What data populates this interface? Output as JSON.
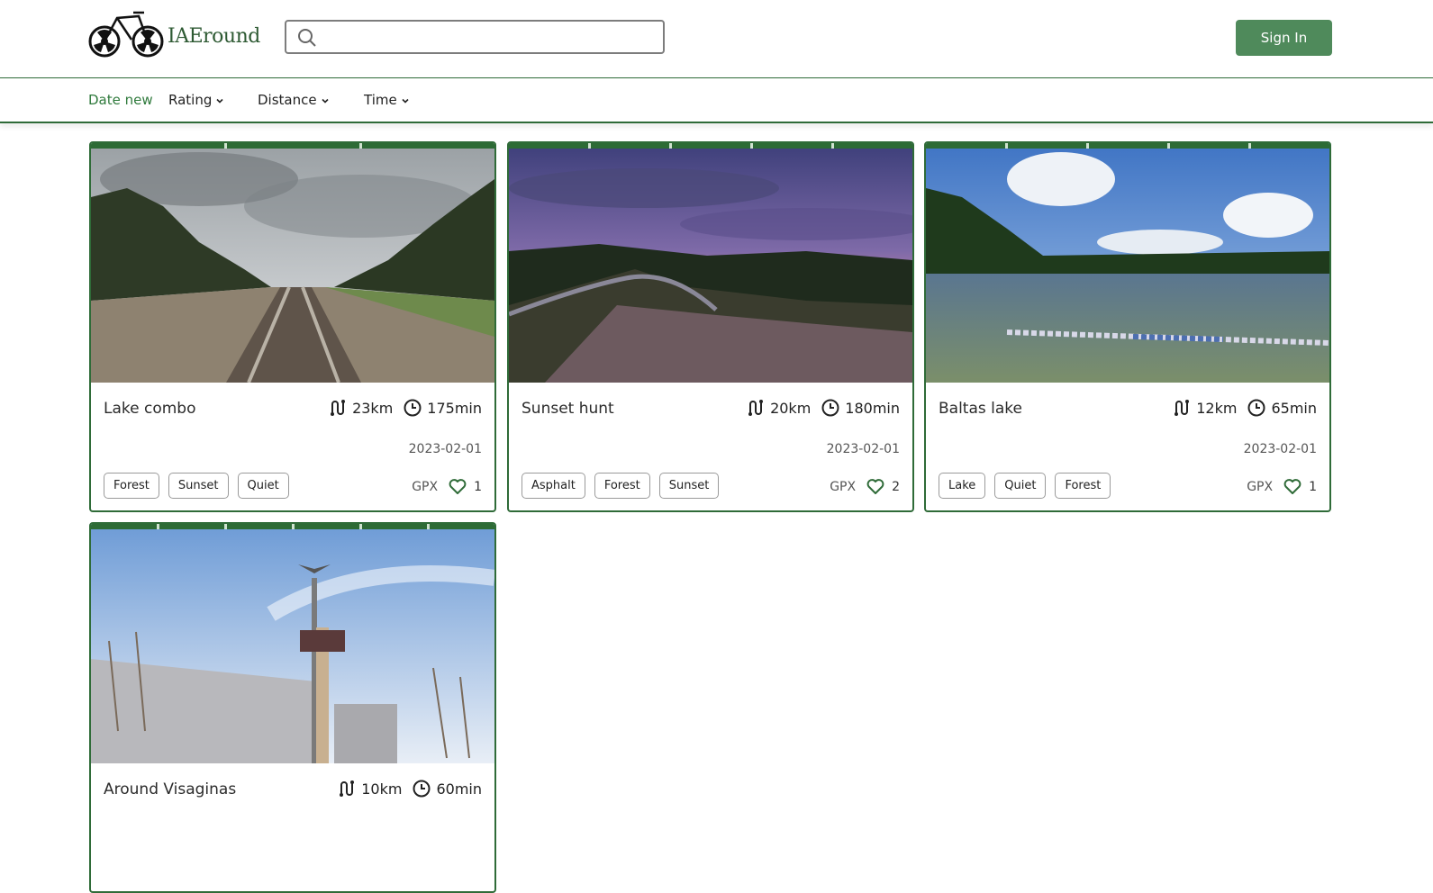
{
  "brand": {
    "name": "IAEround"
  },
  "search": {
    "placeholder": ""
  },
  "header": {
    "signin_label": "Sign In"
  },
  "sort": {
    "date_label": "Date",
    "date_suffix": "new",
    "rating_label": "Rating",
    "distance_label": "Distance",
    "time_label": "Time"
  },
  "colors": {
    "accent": "#2f6b38",
    "button": "#4f8a5b",
    "active_sort": "#2f7a3c"
  },
  "cards": [
    {
      "title": "Lake combo",
      "distance": "23km",
      "time": "175min",
      "date": "2023-02-01",
      "tags": [
        "Forest",
        "Sunset",
        "Quiet"
      ],
      "gpx": "GPX",
      "likes": "1"
    },
    {
      "title": "Sunset hunt",
      "distance": "20km",
      "time": "180min",
      "date": "2023-02-01",
      "tags": [
        "Asphalt",
        "Forest",
        "Sunset"
      ],
      "gpx": "GPX",
      "likes": "2"
    },
    {
      "title": "Baltas lake",
      "distance": "12km",
      "time": "65min",
      "date": "2023-02-01",
      "tags": [
        "Lake",
        "Quiet",
        "Forest"
      ],
      "gpx": "GPX",
      "likes": "1"
    },
    {
      "title": "Around Visaginas",
      "distance": "10km",
      "time": "60min"
    }
  ]
}
